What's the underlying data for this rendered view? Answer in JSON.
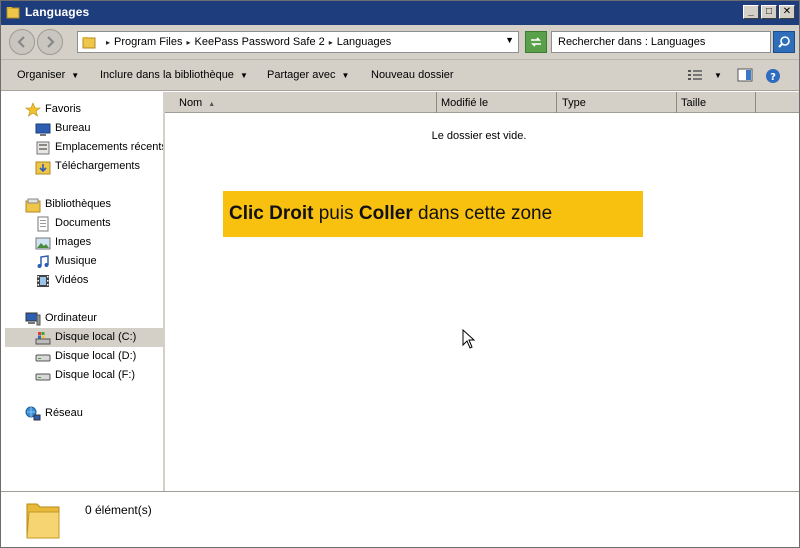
{
  "window": {
    "title": "Languages"
  },
  "window_buttons": {
    "minimize": "_",
    "maximize": "□",
    "close": "✕"
  },
  "address": {
    "crumbs": [
      "Program Files",
      "KeePass Password Safe 2",
      "Languages"
    ],
    "search_placeholder": "Rechercher dans : Languages"
  },
  "toolbar": {
    "organize": "Organiser",
    "include": "Inclure dans la bibliothèque",
    "share": "Partager avec",
    "new_folder": "Nouveau dossier"
  },
  "sidebar": {
    "favorites": "Favoris",
    "fav_items": [
      "Bureau",
      "Emplacements récents",
      "Téléchargements"
    ],
    "libraries": "Bibliothèques",
    "lib_items": [
      "Documents",
      "Images",
      "Musique",
      "Vidéos"
    ],
    "computer": "Ordinateur",
    "drives": [
      "Disque local (C:)",
      "Disque local (D:)",
      "Disque local (F:)"
    ],
    "network": "Réseau"
  },
  "columns": [
    "Nom",
    "Modifié le",
    "Type",
    "Taille"
  ],
  "content": {
    "empty_message": "Le dossier est vide.",
    "banner_part1": "Clic Droit",
    "banner_part2": " puis ",
    "banner_part3": "Coller",
    "banner_part4": " dans cette zone"
  },
  "status": {
    "count": "0 élément(s)"
  },
  "colors": {
    "titlebar": "#1e3d7c",
    "chrome": "#d4d0c8",
    "banner": "#f9c10f",
    "selected": "#d4d0c8"
  }
}
